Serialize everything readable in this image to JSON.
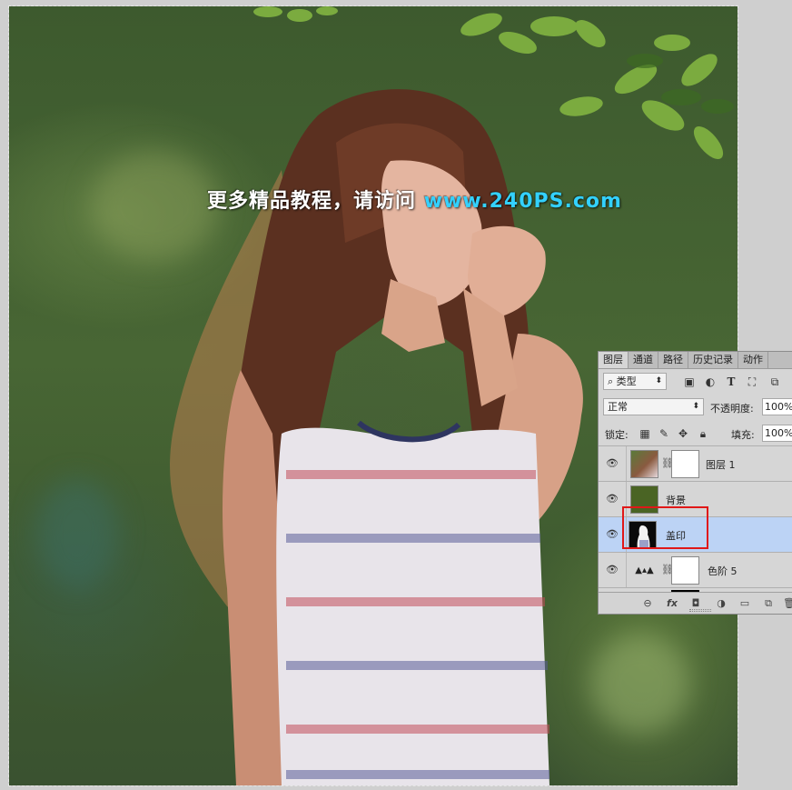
{
  "watermark": {
    "text_cn": "更多精品教程，请访问",
    "site": "www.240PS.com"
  },
  "panel": {
    "tabs": [
      {
        "label": "图层",
        "active": true
      },
      {
        "label": "通道",
        "active": false
      },
      {
        "label": "路径",
        "active": false
      },
      {
        "label": "历史记录",
        "active": false
      },
      {
        "label": "动作",
        "active": false
      }
    ],
    "filter": {
      "kind_label": "类型",
      "icons": [
        "image-filter-icon",
        "adjustment-filter-icon",
        "type-filter-icon",
        "shape-filter-icon",
        "smart-object-filter-icon"
      ]
    },
    "blend_mode": "正常",
    "opacity_label": "不透明度:",
    "opacity_value": "100%",
    "lock_label": "锁定:",
    "fill_label": "填充:",
    "fill_value": "100%",
    "layers": [
      {
        "name": "图层 1",
        "type": "photo-with-mask",
        "selected": false
      },
      {
        "name": "背景",
        "type": "solid-fill",
        "fill_color": "#4a6424",
        "selected": false
      },
      {
        "name": "盖印",
        "type": "stamped",
        "selected": true
      },
      {
        "name": "色阶 5",
        "type": "levels-adjustment",
        "selected": false
      }
    ],
    "footer_icons": [
      "link-icon",
      "fx-icon",
      "add-mask-icon",
      "new-adjustment-icon",
      "new-group-icon",
      "new-layer-icon",
      "delete-icon"
    ],
    "colors": {
      "selected_row": "#bcd3f5",
      "highlight_box": "#e01818"
    }
  }
}
